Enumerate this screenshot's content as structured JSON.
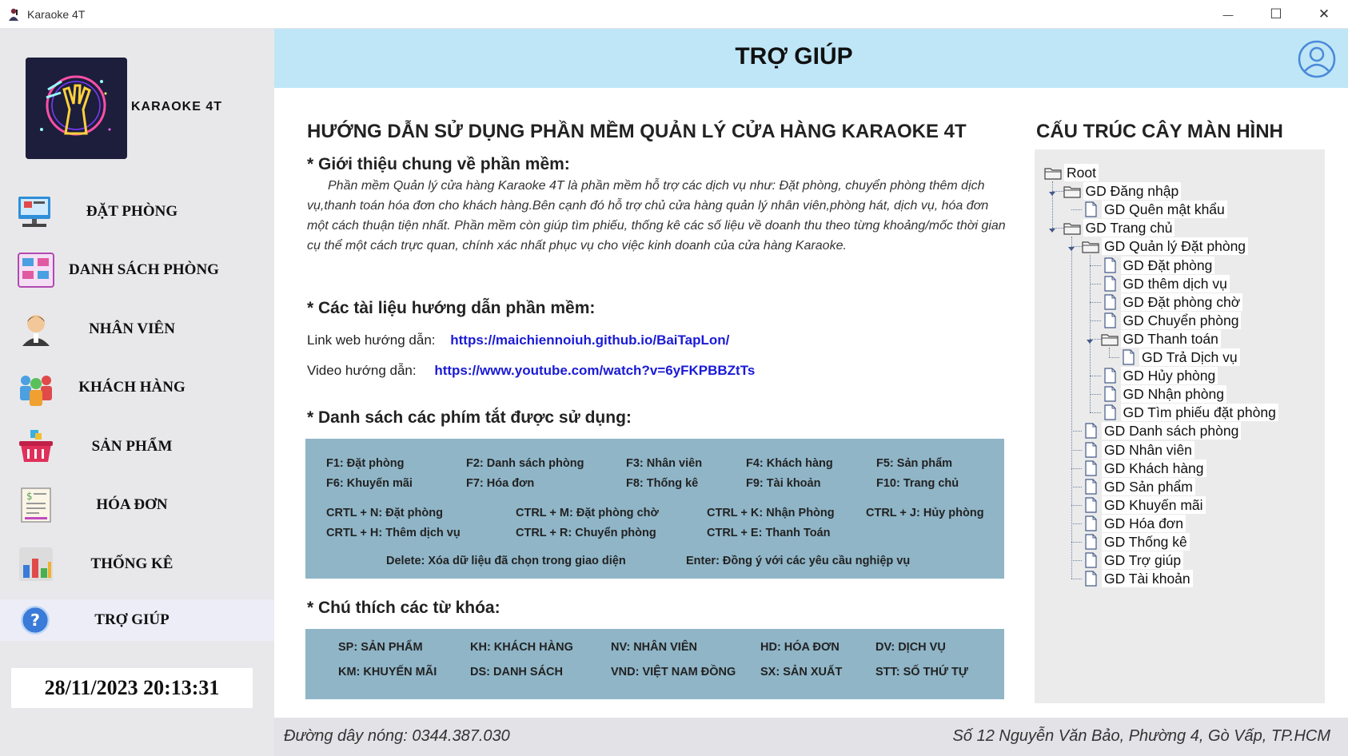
{
  "window": {
    "title": "Karaoke 4T",
    "app_icon": "karaoke-singer-icon",
    "minimize": "—",
    "maximize": "☐",
    "close": "✕"
  },
  "sidebar": {
    "brand": "KARAOKE 4T",
    "items": [
      {
        "label": "ĐẶT PHÒNG",
        "icon": "booking-desk-icon"
      },
      {
        "label": "DANH SÁCH PHÒNG",
        "icon": "room-list-icon"
      },
      {
        "label": "NHÂN VIÊN",
        "icon": "employee-icon"
      },
      {
        "label": "KHÁCH HÀNG",
        "icon": "customers-icon"
      },
      {
        "label": "SẢN PHẨM",
        "icon": "product-basket-icon"
      },
      {
        "label": "HÓA ĐƠN",
        "icon": "invoice-icon"
      },
      {
        "label": "THỐNG KÊ",
        "icon": "statistics-chart-icon"
      },
      {
        "label": "TRỢ GIÚP",
        "icon": "help-question-icon",
        "active": true
      }
    ],
    "clock": "28/11/2023 20:13:31"
  },
  "header": {
    "title": "TRỢ GIÚP",
    "user_icon": "user-account-icon"
  },
  "help": {
    "main_heading": "HƯỚNG DẪN SỬ DỤNG PHẦN MỀM QUẢN LÝ CỬA HÀNG KARAOKE 4T",
    "intro_heading": "* Giới thiệu chung về phần mềm:",
    "intro_text": "Phần mềm Quản lý cửa hàng Karaoke 4T là phần mềm hỗ trợ các dịch vụ như: Đặt phòng, chuyển phòng thêm dịch vụ,thanh toán hóa đơn cho khách hàng.Bên cạnh đó hỗ trợ chủ cửa hàng quản lý nhân viên,phòng hát, dịch vụ, hóa đơn một cách thuận tiện nhất. Phần mềm còn giúp tìm phiếu, thống kê các số liệu về doanh thu theo từng khoảng/mốc thời gian cụ thể một cách trực quan, chính xác nhất phục vụ cho việc kinh doanh của cửa hàng Karaoke.",
    "docs_heading": "* Các tài liệu hướng dẫn phần mềm:",
    "web_label": "Link web hướng dẫn:",
    "web_link": "https://maichiennoiuh.github.io/BaiTapLon/",
    "video_label": "Video hướng dẫn:",
    "video_link": "https://www.youtube.com/watch?v=6yFKPBBZtTs",
    "shortcuts_heading": "* Danh sách các phím tắt được sử dụng:",
    "shortcuts": [
      "F1: Đặt phòng",
      "F2: Danh sách phòng",
      "F3: Nhân viên",
      "F4: Khách hàng",
      "F5: Sản phẩm",
      "F6: Khuyến mãi",
      "F7: Hóa đơn",
      "F8: Thống kê",
      "F9: Tài khoản",
      "F10: Trang chủ",
      "CRTL + N: Đặt phòng",
      "CTRL + M: Đặt phòng chờ",
      "CTRL + K: Nhận Phòng",
      "CTRL + J: Hủy phòng",
      "CRTL + H: Thêm dịch vụ",
      "CTRL + R: Chuyển phòng",
      "CTRL + E: Thanh Toán",
      "Delete: Xóa dữ liệu đã chọn trong giao diện",
      "Enter: Đồng ý với các yêu cầu nghiệp vụ"
    ],
    "keywords_heading": "* Chú thích các từ khóa:",
    "keywords": [
      "SP: SẢN PHẨM",
      "KH: KHÁCH HÀNG",
      "NV: NHÂN VIÊN",
      "HD: HÓA ĐƠN",
      "DV: DỊCH VỤ",
      "KM: KHUYẾN MÃI",
      "DS: DANH SÁCH",
      "VND: VIỆT NAM ĐỒNG",
      "SX: SẢN XUẤT",
      "STT: SỐ THỨ TỰ"
    ]
  },
  "tree": {
    "heading": "CẤU TRÚC CÂY MÀN HÌNH",
    "nodes": [
      {
        "label": "Root",
        "type": "folder"
      },
      {
        "label": "GD Đăng nhập",
        "type": "folder"
      },
      {
        "label": "GD Quên mật khẩu",
        "type": "file"
      },
      {
        "label": "GD Trang chủ",
        "type": "folder"
      },
      {
        "label": "GD Quản lý Đặt phòng",
        "type": "folder"
      },
      {
        "label": "GD Đặt phòng",
        "type": "file"
      },
      {
        "label": "GD thêm dịch vụ",
        "type": "file"
      },
      {
        "label": "GD Đặt phòng chờ",
        "type": "file"
      },
      {
        "label": "GD Chuyển phòng",
        "type": "file"
      },
      {
        "label": "GD Thanh toán",
        "type": "folder"
      },
      {
        "label": "GD Trả Dịch vụ",
        "type": "file"
      },
      {
        "label": "GD Hủy phòng",
        "type": "file"
      },
      {
        "label": "GD Nhận phòng",
        "type": "file"
      },
      {
        "label": "GD Tìm phiếu đặt phòng",
        "type": "file"
      },
      {
        "label": "GD Danh sách phòng",
        "type": "file"
      },
      {
        "label": "GD Nhân viên",
        "type": "file"
      },
      {
        "label": "GD Khách hàng",
        "type": "file"
      },
      {
        "label": "GD Sản phẩm",
        "type": "file"
      },
      {
        "label": "GD Khuyến mãi",
        "type": "file"
      },
      {
        "label": "GD Hóa đơn",
        "type": "file"
      },
      {
        "label": "GD Thống kê",
        "type": "file"
      },
      {
        "label": "GD Trợ giúp",
        "type": "file"
      },
      {
        "label": "GD Tài khoản",
        "type": "file"
      }
    ]
  },
  "footer": {
    "hotline": "Đường dây nóng: 0344.387.030",
    "address": "Số 12 Nguyễn Văn Bảo, Phường 4, Gò Vấp, TP.HCM"
  }
}
